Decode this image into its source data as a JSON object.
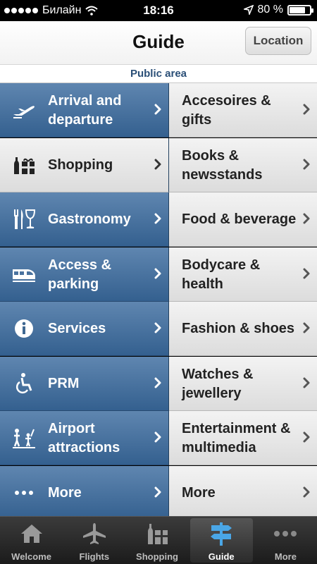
{
  "status": {
    "carrier": "Билайн",
    "time": "18:16",
    "battery": "80 %",
    "battery_level": 0.8
  },
  "nav": {
    "title": "Guide",
    "location_button": "Location"
  },
  "section_header": "Public area",
  "left_items": [
    {
      "label": "Arrival and departure",
      "icon": "plane-icon",
      "selected": false
    },
    {
      "label": "Shopping",
      "icon": "gift-bottle-icon",
      "selected": true
    },
    {
      "label": "Gastronomy",
      "icon": "fork-knife-glass-icon",
      "selected": false
    },
    {
      "label": "Access & parking",
      "icon": "train-icon",
      "selected": false
    },
    {
      "label": "Services",
      "icon": "info-icon",
      "selected": false
    },
    {
      "label": "PRM",
      "icon": "wheelchair-icon",
      "selected": false
    },
    {
      "label": "Airport attractions",
      "icon": "family-attractions-icon",
      "selected": false
    },
    {
      "label": "More",
      "icon": "more-dots-icon",
      "selected": false
    }
  ],
  "right_items": [
    {
      "label": "Accesoires & gifts"
    },
    {
      "label": "Books & newsstands"
    },
    {
      "label": "Food & beverage"
    },
    {
      "label": "Bodycare & health"
    },
    {
      "label": "Fashion & shoes"
    },
    {
      "label": "Watches & jewellery"
    },
    {
      "label": "Entertainment & multimedia"
    },
    {
      "label": "More"
    }
  ],
  "tabs": [
    {
      "label": "Welcome",
      "icon": "home-icon",
      "active": false
    },
    {
      "label": "Flights",
      "icon": "plane-icon",
      "active": false
    },
    {
      "label": "Shopping",
      "icon": "shopping-icon",
      "active": false
    },
    {
      "label": "Guide",
      "icon": "signpost-icon",
      "active": true
    },
    {
      "label": "More",
      "icon": "more-dots-icon",
      "active": false
    }
  ],
  "colors": {
    "left_cell": "#4a739f",
    "selected_cell": "#e6e6e6",
    "right_cell": "#e6e6e6",
    "section_text": "#2b4f77",
    "active_tab_icon": "#4aa6e6"
  }
}
